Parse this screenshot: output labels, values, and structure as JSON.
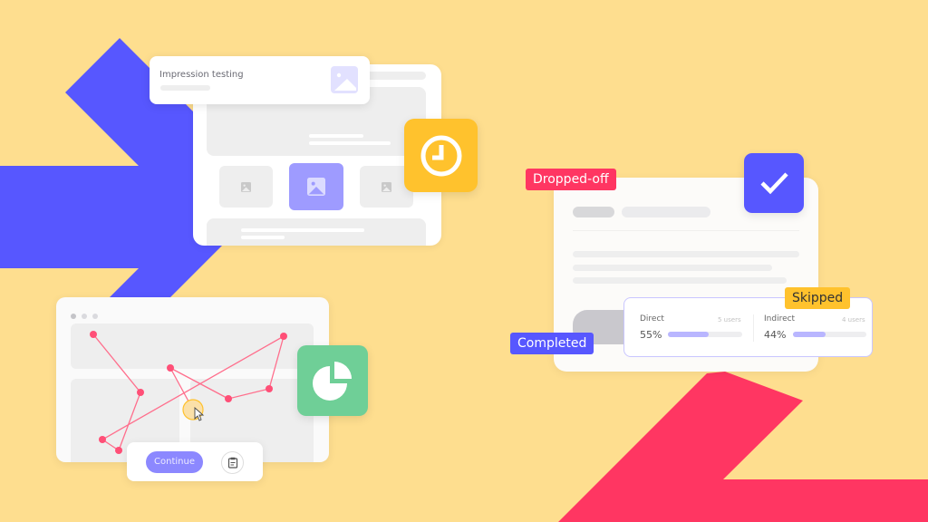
{
  "colors": {
    "background": "#FEDE8F",
    "blue_arrow": "#5757FF",
    "red_arrow": "#FF3662",
    "clock_tile": "#FFC22D",
    "check_tile": "#5757FF",
    "pie_tile": "#6FCF97",
    "heatmap_path": "#FF4F77"
  },
  "impression_card": {
    "title": "Impression testing",
    "image_icon": "image-icon"
  },
  "icons": {
    "clock": "clock-icon",
    "check": "check-icon",
    "pie": "pie-chart-icon",
    "cursor": "cursor-icon",
    "clipboard": "clipboard-icon"
  },
  "survey": {
    "tags": {
      "dropped_off": "Dropped-off",
      "completed": "Completed",
      "skipped": "Skipped"
    },
    "stats": [
      {
        "label": "Direct",
        "users": "5 users",
        "percent_text": "55%",
        "fraction": 0.55
      },
      {
        "label": "Indirect",
        "users": "4 users",
        "percent_text": "44%",
        "fraction": 0.44
      }
    ]
  },
  "heatmap_window": {
    "continue_label": "Continue"
  }
}
